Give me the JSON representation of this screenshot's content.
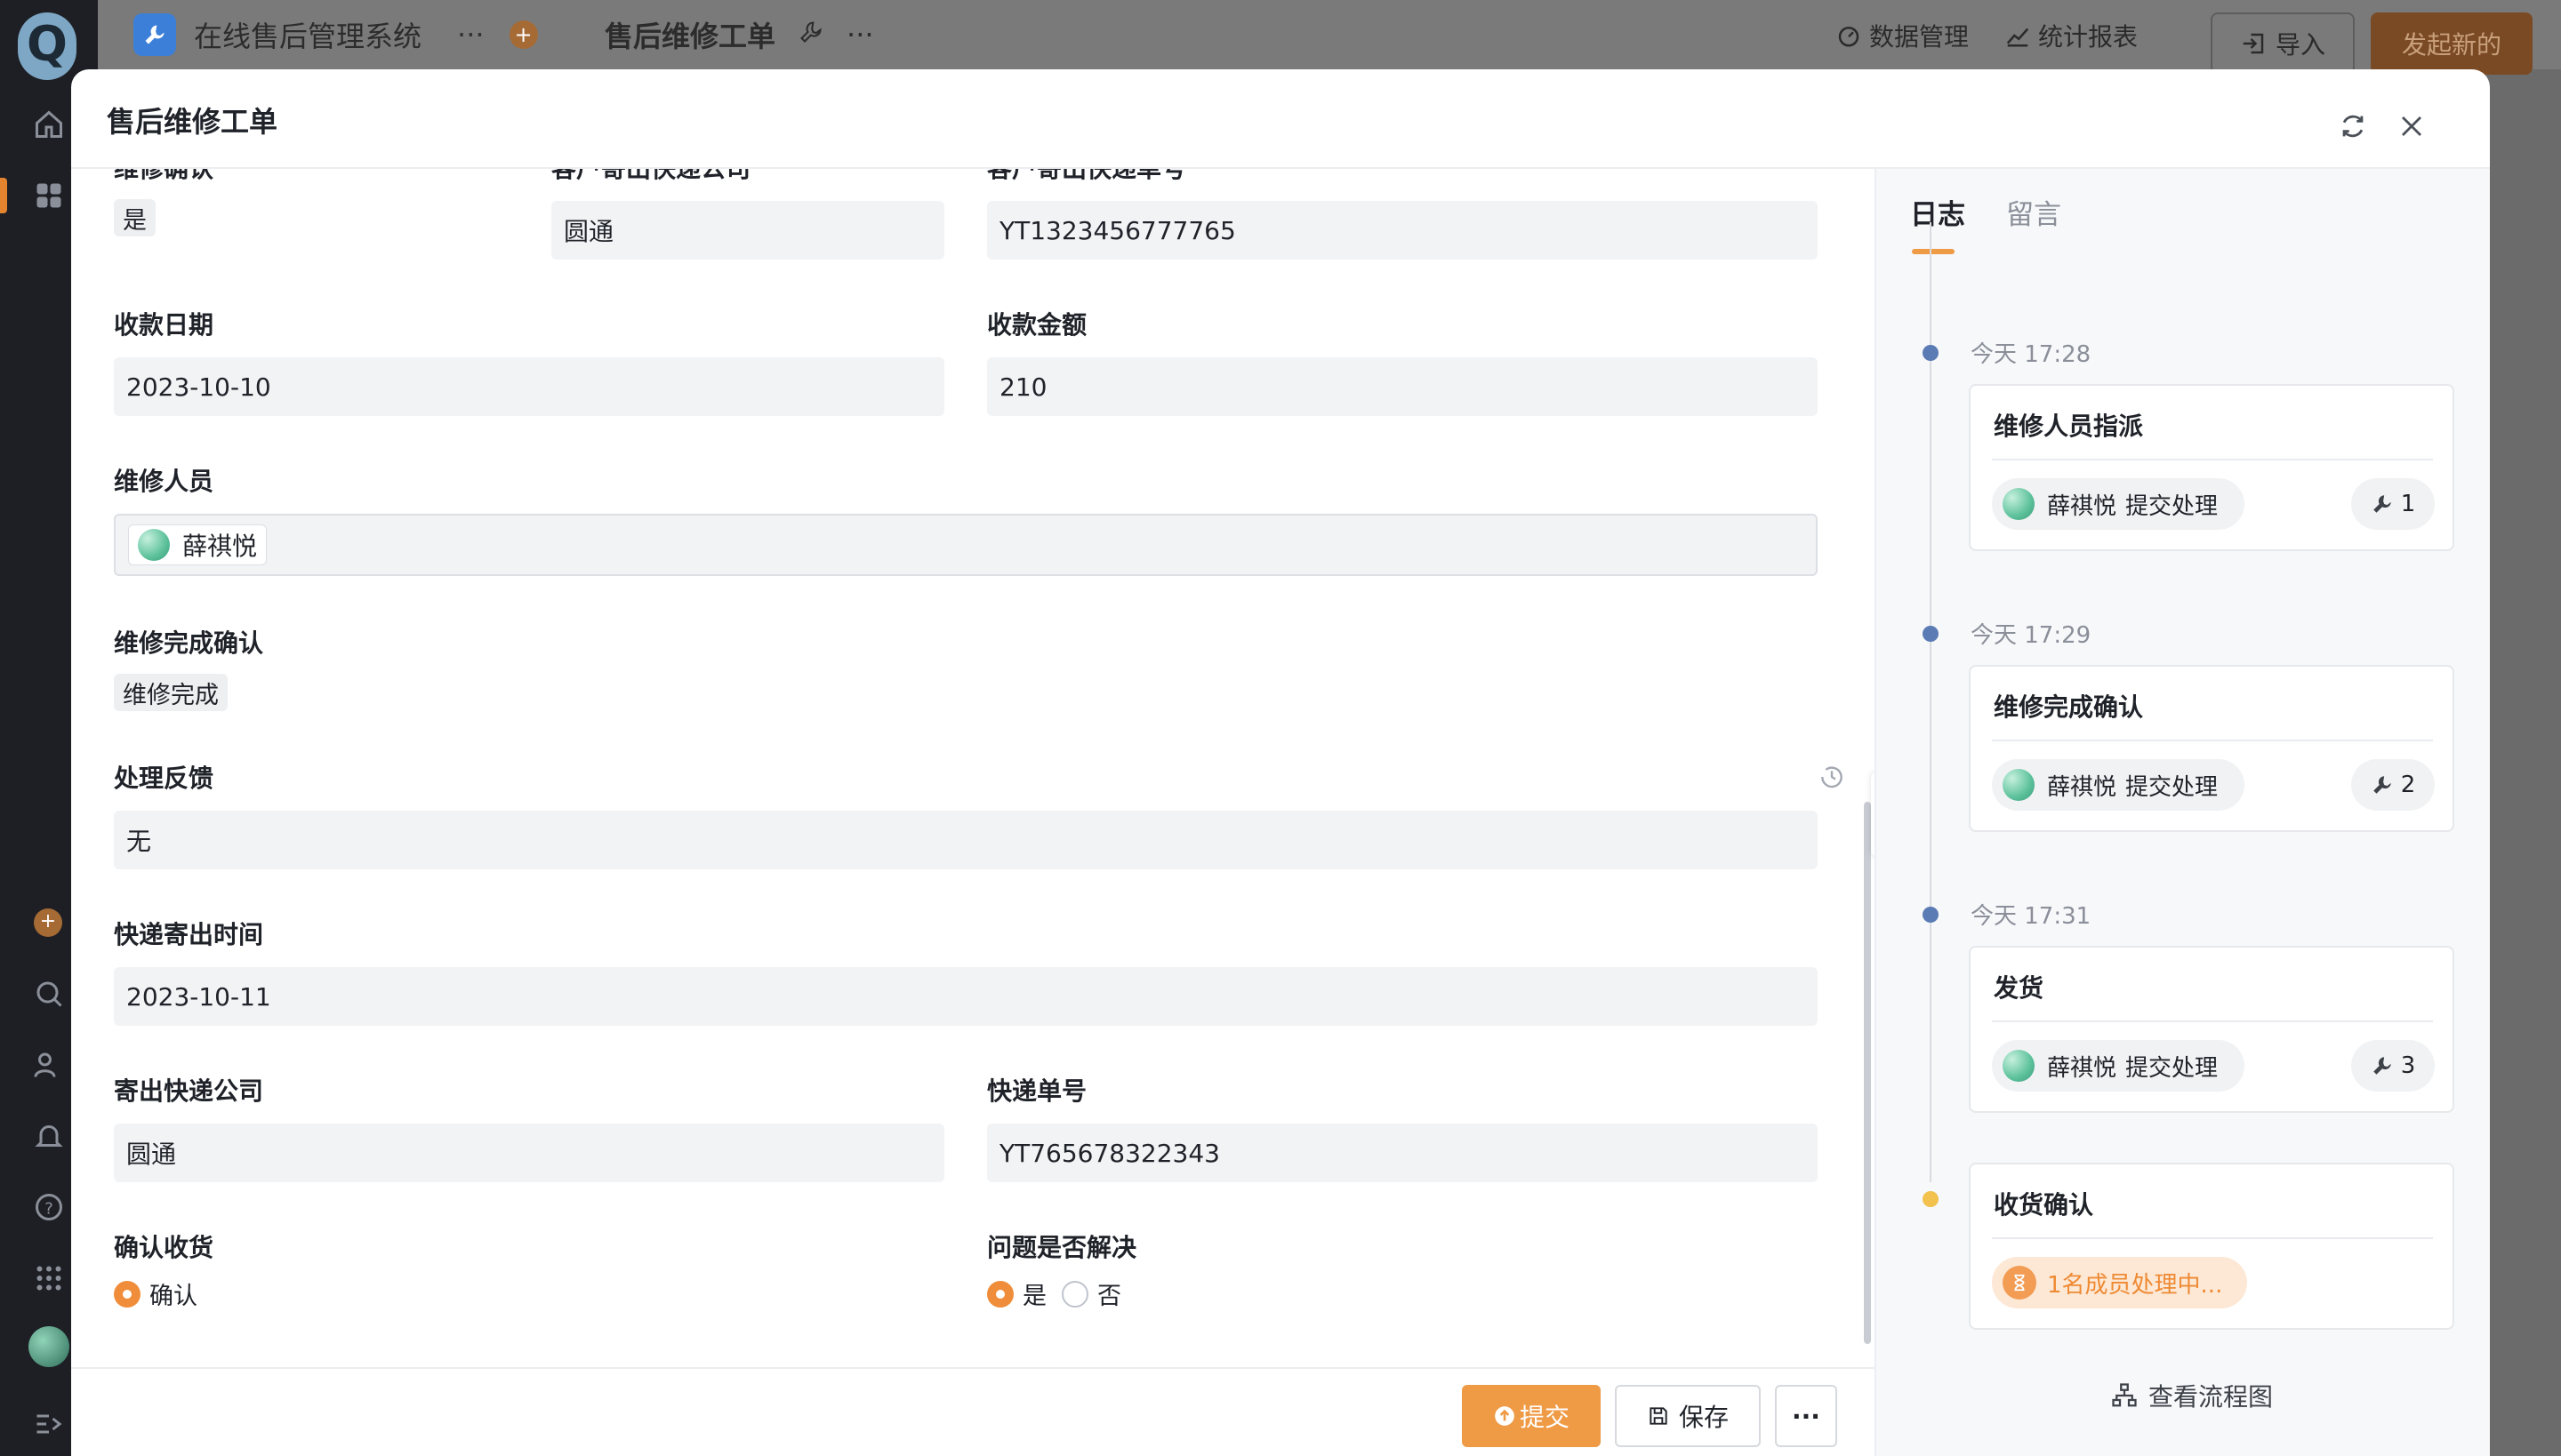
{
  "colors": {
    "accent": "#EF9A45",
    "timeline_done": "#5A7BB4",
    "timeline_pending": "#F2C14E"
  },
  "topbar": {
    "app_name": "在线售后管理系统",
    "page_name": "售后维修工单",
    "data_manage": "数据管理",
    "report": "统计报表",
    "import_label": "导入",
    "launch_label": "发起新的"
  },
  "modal": {
    "title": "售后维修工单"
  },
  "form": {
    "repair_confirm": {
      "label": "维修确认",
      "value": "是"
    },
    "customer_courier": {
      "label": "客户寄出快递公司",
      "value": "圆通"
    },
    "customer_tracking": {
      "label": "客户寄出快递单号",
      "value": "YT1323456777765"
    },
    "payment_date": {
      "label": "收款日期",
      "value": "2023-10-10"
    },
    "payment_amount": {
      "label": "收款金额",
      "value": "210"
    },
    "repair_staff": {
      "label": "维修人员",
      "value": "薛祺悦"
    },
    "completion_confirm": {
      "label": "维修完成确认",
      "value": "维修完成"
    },
    "feedback": {
      "label": "处理反馈",
      "value": "无"
    },
    "ship_time": {
      "label": "快递寄出时间",
      "value": "2023-10-11"
    },
    "ship_courier": {
      "label": "寄出快递公司",
      "value": "圆通"
    },
    "ship_tracking": {
      "label": "快递单号",
      "value": "YT765678322343"
    },
    "receipt_confirm": {
      "label": "确认收货",
      "option": "确认"
    },
    "problem_solved": {
      "label": "问题是否解决",
      "option_yes": "是",
      "option_no": "否"
    }
  },
  "footer": {
    "submit": "提交",
    "save": "保存",
    "more": "···"
  },
  "side": {
    "tab_log": "日志",
    "tab_comment": "留言",
    "entries": [
      {
        "time": "今天 17:28",
        "title": "维修人员指派",
        "user": "薛祺悦",
        "action": "提交处理",
        "count": "1"
      },
      {
        "time": "今天 17:29",
        "title": "维修完成确认",
        "user": "薛祺悦",
        "action": "提交处理",
        "count": "2"
      },
      {
        "time": "今天 17:31",
        "title": "发货",
        "user": "薛祺悦",
        "action": "提交处理",
        "count": "3"
      }
    ],
    "pending": {
      "title": "收货确认",
      "status": "1名成员处理中..."
    },
    "flow_link": "查看流程图"
  }
}
